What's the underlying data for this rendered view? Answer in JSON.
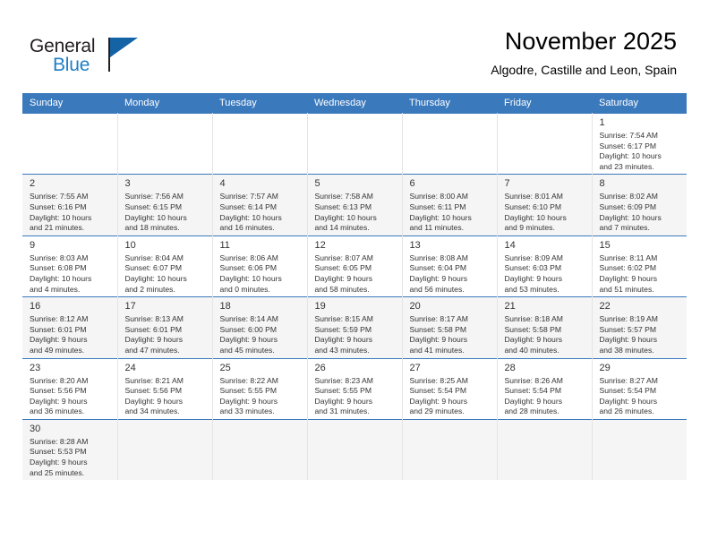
{
  "brand": {
    "name_top": "General",
    "name_bottom": "Blue",
    "accent_color": "#1463a5",
    "text_color": "#231f20"
  },
  "header": {
    "month_title": "November 2025",
    "location": "Algodre, Castille and Leon, Spain"
  },
  "calendar": {
    "header_bg": "#3b79bd",
    "weekdays": [
      "Sunday",
      "Monday",
      "Tuesday",
      "Wednesday",
      "Thursday",
      "Friday",
      "Saturday"
    ],
    "weeks": [
      [
        {
          "day": "",
          "empty": true
        },
        {
          "day": "",
          "empty": true
        },
        {
          "day": "",
          "empty": true
        },
        {
          "day": "",
          "empty": true
        },
        {
          "day": "",
          "empty": true
        },
        {
          "day": "",
          "empty": true
        },
        {
          "day": "1",
          "sunrise": "Sunrise: 7:54 AM",
          "sunset": "Sunset: 6:17 PM",
          "daylight1": "Daylight: 10 hours",
          "daylight2": "and 23 minutes."
        }
      ],
      [
        {
          "day": "2",
          "sunrise": "Sunrise: 7:55 AM",
          "sunset": "Sunset: 6:16 PM",
          "daylight1": "Daylight: 10 hours",
          "daylight2": "and 21 minutes."
        },
        {
          "day": "3",
          "sunrise": "Sunrise: 7:56 AM",
          "sunset": "Sunset: 6:15 PM",
          "daylight1": "Daylight: 10 hours",
          "daylight2": "and 18 minutes."
        },
        {
          "day": "4",
          "sunrise": "Sunrise: 7:57 AM",
          "sunset": "Sunset: 6:14 PM",
          "daylight1": "Daylight: 10 hours",
          "daylight2": "and 16 minutes."
        },
        {
          "day": "5",
          "sunrise": "Sunrise: 7:58 AM",
          "sunset": "Sunset: 6:13 PM",
          "daylight1": "Daylight: 10 hours",
          "daylight2": "and 14 minutes."
        },
        {
          "day": "6",
          "sunrise": "Sunrise: 8:00 AM",
          "sunset": "Sunset: 6:11 PM",
          "daylight1": "Daylight: 10 hours",
          "daylight2": "and 11 minutes."
        },
        {
          "day": "7",
          "sunrise": "Sunrise: 8:01 AM",
          "sunset": "Sunset: 6:10 PM",
          "daylight1": "Daylight: 10 hours",
          "daylight2": "and 9 minutes."
        },
        {
          "day": "8",
          "sunrise": "Sunrise: 8:02 AM",
          "sunset": "Sunset: 6:09 PM",
          "daylight1": "Daylight: 10 hours",
          "daylight2": "and 7 minutes."
        }
      ],
      [
        {
          "day": "9",
          "sunrise": "Sunrise: 8:03 AM",
          "sunset": "Sunset: 6:08 PM",
          "daylight1": "Daylight: 10 hours",
          "daylight2": "and 4 minutes."
        },
        {
          "day": "10",
          "sunrise": "Sunrise: 8:04 AM",
          "sunset": "Sunset: 6:07 PM",
          "daylight1": "Daylight: 10 hours",
          "daylight2": "and 2 minutes."
        },
        {
          "day": "11",
          "sunrise": "Sunrise: 8:06 AM",
          "sunset": "Sunset: 6:06 PM",
          "daylight1": "Daylight: 10 hours",
          "daylight2": "and 0 minutes."
        },
        {
          "day": "12",
          "sunrise": "Sunrise: 8:07 AM",
          "sunset": "Sunset: 6:05 PM",
          "daylight1": "Daylight: 9 hours",
          "daylight2": "and 58 minutes."
        },
        {
          "day": "13",
          "sunrise": "Sunrise: 8:08 AM",
          "sunset": "Sunset: 6:04 PM",
          "daylight1": "Daylight: 9 hours",
          "daylight2": "and 56 minutes."
        },
        {
          "day": "14",
          "sunrise": "Sunrise: 8:09 AM",
          "sunset": "Sunset: 6:03 PM",
          "daylight1": "Daylight: 9 hours",
          "daylight2": "and 53 minutes."
        },
        {
          "day": "15",
          "sunrise": "Sunrise: 8:11 AM",
          "sunset": "Sunset: 6:02 PM",
          "daylight1": "Daylight: 9 hours",
          "daylight2": "and 51 minutes."
        }
      ],
      [
        {
          "day": "16",
          "sunrise": "Sunrise: 8:12 AM",
          "sunset": "Sunset: 6:01 PM",
          "daylight1": "Daylight: 9 hours",
          "daylight2": "and 49 minutes."
        },
        {
          "day": "17",
          "sunrise": "Sunrise: 8:13 AM",
          "sunset": "Sunset: 6:01 PM",
          "daylight1": "Daylight: 9 hours",
          "daylight2": "and 47 minutes."
        },
        {
          "day": "18",
          "sunrise": "Sunrise: 8:14 AM",
          "sunset": "Sunset: 6:00 PM",
          "daylight1": "Daylight: 9 hours",
          "daylight2": "and 45 minutes."
        },
        {
          "day": "19",
          "sunrise": "Sunrise: 8:15 AM",
          "sunset": "Sunset: 5:59 PM",
          "daylight1": "Daylight: 9 hours",
          "daylight2": "and 43 minutes."
        },
        {
          "day": "20",
          "sunrise": "Sunrise: 8:17 AM",
          "sunset": "Sunset: 5:58 PM",
          "daylight1": "Daylight: 9 hours",
          "daylight2": "and 41 minutes."
        },
        {
          "day": "21",
          "sunrise": "Sunrise: 8:18 AM",
          "sunset": "Sunset: 5:58 PM",
          "daylight1": "Daylight: 9 hours",
          "daylight2": "and 40 minutes."
        },
        {
          "day": "22",
          "sunrise": "Sunrise: 8:19 AM",
          "sunset": "Sunset: 5:57 PM",
          "daylight1": "Daylight: 9 hours",
          "daylight2": "and 38 minutes."
        }
      ],
      [
        {
          "day": "23",
          "sunrise": "Sunrise: 8:20 AM",
          "sunset": "Sunset: 5:56 PM",
          "daylight1": "Daylight: 9 hours",
          "daylight2": "and 36 minutes."
        },
        {
          "day": "24",
          "sunrise": "Sunrise: 8:21 AM",
          "sunset": "Sunset: 5:56 PM",
          "daylight1": "Daylight: 9 hours",
          "daylight2": "and 34 minutes."
        },
        {
          "day": "25",
          "sunrise": "Sunrise: 8:22 AM",
          "sunset": "Sunset: 5:55 PM",
          "daylight1": "Daylight: 9 hours",
          "daylight2": "and 33 minutes."
        },
        {
          "day": "26",
          "sunrise": "Sunrise: 8:23 AM",
          "sunset": "Sunset: 5:55 PM",
          "daylight1": "Daylight: 9 hours",
          "daylight2": "and 31 minutes."
        },
        {
          "day": "27",
          "sunrise": "Sunrise: 8:25 AM",
          "sunset": "Sunset: 5:54 PM",
          "daylight1": "Daylight: 9 hours",
          "daylight2": "and 29 minutes."
        },
        {
          "day": "28",
          "sunrise": "Sunrise: 8:26 AM",
          "sunset": "Sunset: 5:54 PM",
          "daylight1": "Daylight: 9 hours",
          "daylight2": "and 28 minutes."
        },
        {
          "day": "29",
          "sunrise": "Sunrise: 8:27 AM",
          "sunset": "Sunset: 5:54 PM",
          "daylight1": "Daylight: 9 hours",
          "daylight2": "and 26 minutes."
        }
      ],
      [
        {
          "day": "30",
          "sunrise": "Sunrise: 8:28 AM",
          "sunset": "Sunset: 5:53 PM",
          "daylight1": "Daylight: 9 hours",
          "daylight2": "and 25 minutes."
        },
        {
          "day": "",
          "empty": true
        },
        {
          "day": "",
          "empty": true
        },
        {
          "day": "",
          "empty": true
        },
        {
          "day": "",
          "empty": true
        },
        {
          "day": "",
          "empty": true
        },
        {
          "day": "",
          "empty": true
        }
      ]
    ]
  }
}
